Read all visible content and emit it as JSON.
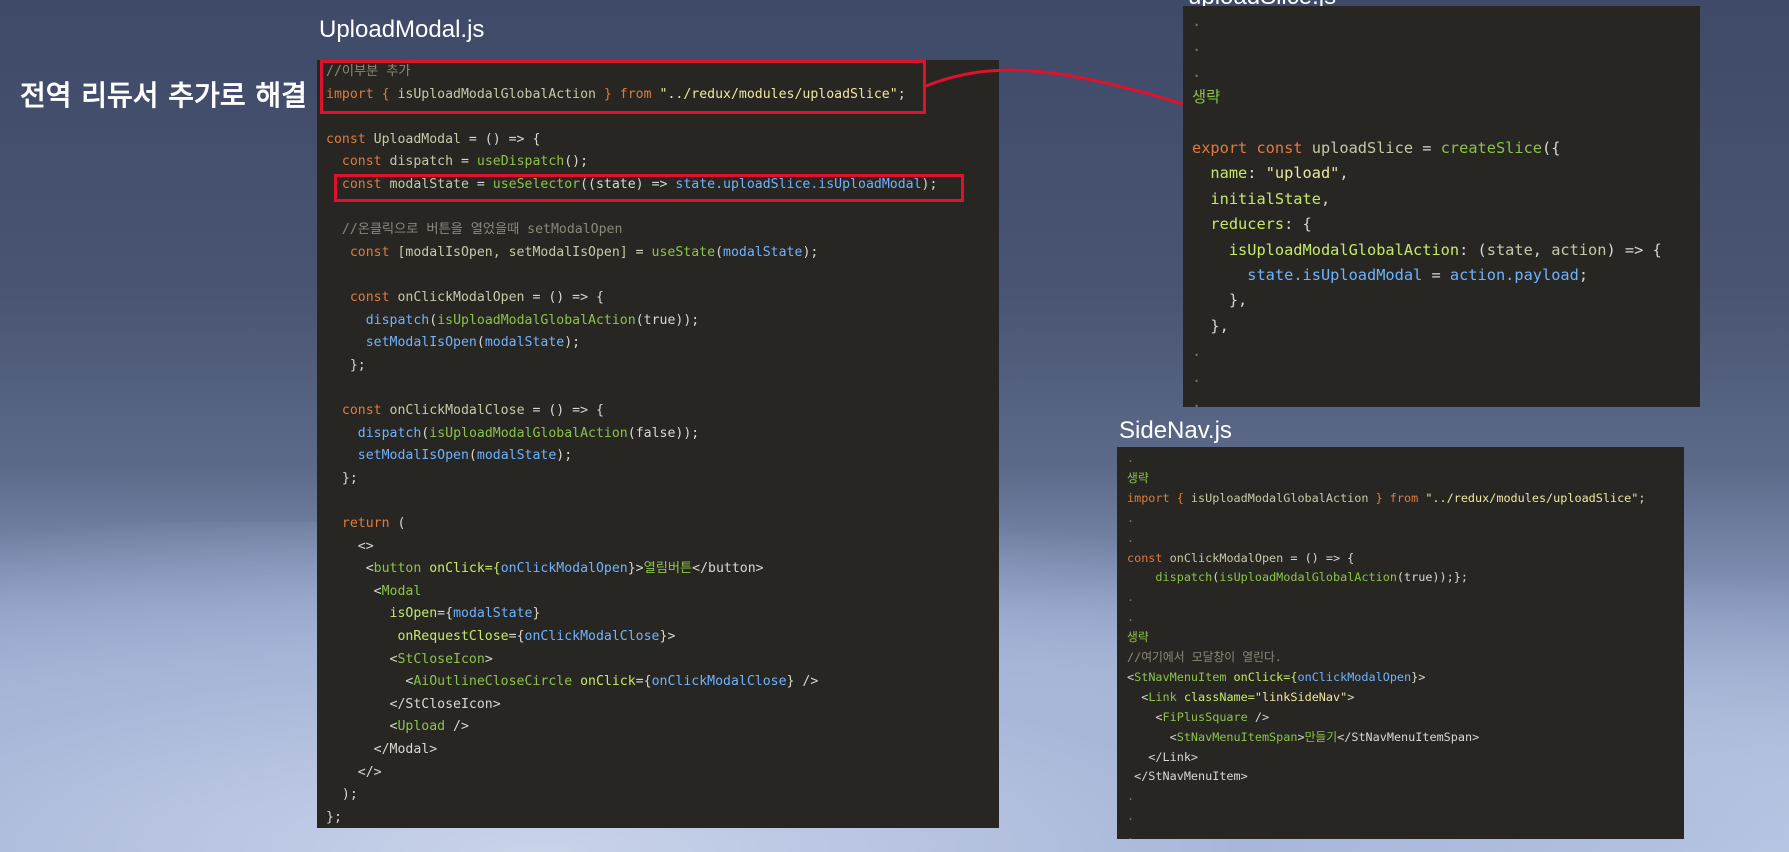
{
  "heading": "전역 리듀서 추가로 해결",
  "titles": {
    "upload_modal": "UploadModal.js",
    "upload_slice": "uploadSlice.js",
    "side_nav": "SideNav.js"
  },
  "colors": {
    "highlight": "#e0112b",
    "panel_bg": "#272622"
  },
  "upload_modal_code": [
    [
      [
        "//이부분 추가",
        "cm"
      ]
    ],
    [
      [
        "import { ",
        "kw"
      ],
      [
        "isUploadModalGlobalAction",
        "var"
      ],
      [
        " } from ",
        "kw"
      ],
      [
        "\"../redux/modules/uploadSlice\"",
        "str"
      ],
      [
        ";",
        "plain"
      ]
    ],
    [],
    [
      [
        "const ",
        "kw"
      ],
      [
        "UploadModal",
        "var"
      ],
      [
        " = () => {",
        "plain"
      ]
    ],
    [
      [
        "  const ",
        "kw"
      ],
      [
        "dispatch",
        "var"
      ],
      [
        " = ",
        "plain"
      ],
      [
        "useDispatch",
        "fn"
      ],
      [
        "();",
        "plain"
      ]
    ],
    [
      [
        "  const ",
        "kw"
      ],
      [
        "modalState",
        "var"
      ],
      [
        " = ",
        "plain"
      ],
      [
        "useSelector",
        "fn"
      ],
      [
        "((state) => ",
        "plain"
      ],
      [
        "state.uploadSlice.isUploadModal",
        "blue"
      ],
      [
        ");",
        "plain"
      ]
    ],
    [],
    [
      [
        "  //온클릭으로 버튼을 열었을때 setModalOpen",
        "cm"
      ]
    ],
    [
      [
        "   const ",
        "kw"
      ],
      [
        "[modalIsOpen, setModalIsOpen]",
        "var"
      ],
      [
        " = ",
        "plain"
      ],
      [
        "useState",
        "fn"
      ],
      [
        "(",
        "plain"
      ],
      [
        "modalState",
        "blue"
      ],
      [
        ");",
        "plain"
      ]
    ],
    [],
    [
      [
        "   const ",
        "kw"
      ],
      [
        "onClickModalOpen",
        "var"
      ],
      [
        " = () => {",
        "plain"
      ]
    ],
    [
      [
        "     ",
        "plain"
      ],
      [
        "dispatch",
        "blue"
      ],
      [
        "(",
        "plain"
      ],
      [
        "isUploadModalGlobalAction",
        "fn"
      ],
      [
        "(true));",
        "plain"
      ]
    ],
    [
      [
        "     ",
        "plain"
      ],
      [
        "setModalIsOpen",
        "blue"
      ],
      [
        "(",
        "plain"
      ],
      [
        "modalState",
        "blue"
      ],
      [
        ");",
        "plain"
      ]
    ],
    [
      [
        "   };",
        "plain"
      ]
    ],
    [],
    [
      [
        "  const ",
        "kw"
      ],
      [
        "onClickModalClose",
        "var"
      ],
      [
        " = () => {",
        "plain"
      ]
    ],
    [
      [
        "    ",
        "plain"
      ],
      [
        "dispatch",
        "blue"
      ],
      [
        "(",
        "plain"
      ],
      [
        "isUploadModalGlobalAction",
        "fn"
      ],
      [
        "(false));",
        "plain"
      ]
    ],
    [
      [
        "    ",
        "plain"
      ],
      [
        "setModalIsOpen",
        "blue"
      ],
      [
        "(",
        "plain"
      ],
      [
        "modalState",
        "blue"
      ],
      [
        ");",
        "plain"
      ]
    ],
    [
      [
        "  };",
        "plain"
      ]
    ],
    [],
    [
      [
        "  return ",
        "kw"
      ],
      [
        "(",
        "plain"
      ]
    ],
    [
      [
        "    <>",
        "plain"
      ]
    ],
    [
      [
        "     <",
        "plain"
      ],
      [
        "button",
        "tag"
      ],
      [
        " onClick={",
        "prop"
      ],
      [
        "onClickModalOpen",
        "blue"
      ],
      [
        "}>",
        "plain"
      ],
      [
        "열림버튼",
        "fn"
      ],
      [
        "</button>",
        "plain"
      ]
    ],
    [
      [
        "      <",
        "plain"
      ],
      [
        "Modal",
        "tag"
      ]
    ],
    [
      [
        "        ",
        "plain"
      ],
      [
        "isOpen",
        "prop"
      ],
      [
        "={",
        "plain"
      ],
      [
        "modalState",
        "blue"
      ],
      [
        "}",
        "plain"
      ]
    ],
    [
      [
        "         ",
        "plain"
      ],
      [
        "onRequestClose",
        "prop"
      ],
      [
        "={",
        "plain"
      ],
      [
        "onClickModalClose",
        "blue"
      ],
      [
        "}>",
        "plain"
      ]
    ],
    [
      [
        "        <",
        "plain"
      ],
      [
        "StCloseIcon",
        "tag"
      ],
      [
        ">",
        "plain"
      ]
    ],
    [
      [
        "          <",
        "plain"
      ],
      [
        "AiOutlineCloseCircle",
        "tag"
      ],
      [
        " onClick",
        "prop"
      ],
      [
        "={",
        "plain"
      ],
      [
        "onClickModalClose",
        "blue"
      ],
      [
        "} />",
        "plain"
      ]
    ],
    [
      [
        "        </StCloseIcon>",
        "plain"
      ]
    ],
    [
      [
        "        <",
        "plain"
      ],
      [
        "Upload",
        "tag"
      ],
      [
        " />",
        "plain"
      ]
    ],
    [
      [
        "      </Modal>",
        "plain"
      ]
    ],
    [
      [
        "    </>",
        "plain"
      ]
    ],
    [
      [
        "  );",
        "plain"
      ]
    ],
    [
      [
        "};",
        "plain"
      ]
    ]
  ],
  "upload_slice_code": [
    [
      [
        ".",
        "dot"
      ]
    ],
    [
      [
        ".",
        "dot"
      ]
    ],
    [
      [
        ".",
        "dot"
      ]
    ],
    [
      [
        "생략",
        "fn"
      ]
    ],
    [],
    [
      [
        "export const ",
        "kw"
      ],
      [
        "uploadSlice",
        "var"
      ],
      [
        " = ",
        "plain"
      ],
      [
        "createSlice",
        "fn"
      ],
      [
        "({",
        "plain"
      ]
    ],
    [
      [
        "  ",
        "plain"
      ],
      [
        "name",
        "prop"
      ],
      [
        ": ",
        "plain"
      ],
      [
        "\"upload\"",
        "str"
      ],
      [
        ",",
        "plain"
      ]
    ],
    [
      [
        "  ",
        "plain"
      ],
      [
        "initialState",
        "prop"
      ],
      [
        ",",
        "plain"
      ]
    ],
    [
      [
        "  ",
        "plain"
      ],
      [
        "reducers",
        "prop"
      ],
      [
        ": {",
        "plain"
      ]
    ],
    [
      [
        "    ",
        "plain"
      ],
      [
        "isUploadModalGlobalAction",
        "prop"
      ],
      [
        ": (",
        "plain"
      ],
      [
        "state",
        "var"
      ],
      [
        ", ",
        "plain"
      ],
      [
        "action",
        "var"
      ],
      [
        ") => {",
        "plain"
      ]
    ],
    [
      [
        "      ",
        "plain"
      ],
      [
        "state.isUploadModal",
        "blue"
      ],
      [
        " = ",
        "plain"
      ],
      [
        "action.payload",
        "blue"
      ],
      [
        ";",
        "plain"
      ]
    ],
    [
      [
        "    },",
        "plain"
      ]
    ],
    [
      [
        "  },",
        "plain"
      ]
    ],
    [
      [
        ".",
        "dot"
      ]
    ],
    [
      [
        ".",
        "dot"
      ]
    ],
    [
      [
        ".",
        "dot"
      ]
    ]
  ],
  "side_nav_code": [
    [
      [
        ".",
        "dot"
      ]
    ],
    [
      [
        "생략",
        "fn"
      ]
    ],
    [
      [
        "import { ",
        "kw"
      ],
      [
        "isUploadModalGlobalAction",
        "var"
      ],
      [
        " } from ",
        "kw"
      ],
      [
        "\"../redux/modules/uploadSlice\"",
        "str"
      ],
      [
        ";",
        "plain"
      ]
    ],
    [
      [
        ".",
        "dot"
      ]
    ],
    [
      [
        ".",
        "dot"
      ]
    ],
    [
      [
        "const ",
        "kw"
      ],
      [
        "onClickModalOpen",
        "var"
      ],
      [
        " = () => {",
        "plain"
      ]
    ],
    [
      [
        "    ",
        "plain"
      ],
      [
        "dispatch",
        "fn"
      ],
      [
        "(",
        "plain"
      ],
      [
        "isUploadModalGlobalAction",
        "fn"
      ],
      [
        "(true));};",
        "plain"
      ]
    ],
    [
      [
        ".",
        "dot"
      ]
    ],
    [
      [
        ".",
        "dot"
      ]
    ],
    [
      [
        "생략",
        "fn"
      ]
    ],
    [
      [
        "//여기에서 모달창이 열린다.",
        "cm"
      ]
    ],
    [
      [
        "<",
        "plain"
      ],
      [
        "StNavMenuItem",
        "tag"
      ],
      [
        " onClick={",
        "prop"
      ],
      [
        "onClickModalOpen",
        "blue"
      ],
      [
        "}>",
        "plain"
      ]
    ],
    [
      [
        "  <",
        "plain"
      ],
      [
        "Link",
        "tag"
      ],
      [
        " className=",
        "prop"
      ],
      [
        "\"linkSideNav\"",
        "str"
      ],
      [
        ">",
        "plain"
      ]
    ],
    [
      [
        "    <",
        "plain"
      ],
      [
        "FiPlusSquare",
        "tag"
      ],
      [
        " />",
        "plain"
      ]
    ],
    [
      [
        "      <",
        "plain"
      ],
      [
        "StNavMenuItemSpan",
        "tag"
      ],
      [
        ">",
        "plain"
      ],
      [
        "만들기",
        "fn"
      ],
      [
        "</StNavMenuItemSpan>",
        "plain"
      ]
    ],
    [
      [
        "   </Link>",
        "plain"
      ]
    ],
    [
      [
        " </StNavMenuItem>",
        "plain"
      ]
    ],
    [
      [
        ".",
        "dot"
      ]
    ],
    [
      [
        ".",
        "dot"
      ]
    ],
    [
      [
        ".",
        "dot"
      ]
    ]
  ]
}
